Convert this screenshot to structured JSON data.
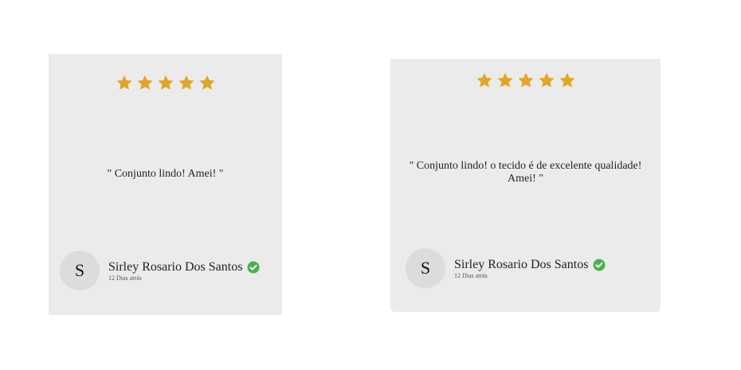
{
  "colors": {
    "card_background": "#ebebeb",
    "star": "#e2a526",
    "verified": "#4caf50",
    "avatar_background": "#dcdcdc"
  },
  "reviews": [
    {
      "rating": 5,
      "text": "\" Conjunto lindo! Amei! \"",
      "author_initial": "S",
      "author_name": "Sirley Rosario Dos Santos",
      "date": "12 Dias atrás",
      "verified_icon": "check-circle-icon"
    },
    {
      "rating": 5,
      "text": "\" Conjunto lindo! o tecido é de excelente qualidade! Amei! \"",
      "author_initial": "S",
      "author_name": "Sirley Rosario Dos Santos",
      "date": "12 Dias atrás",
      "verified_icon": "check-circle-icon"
    }
  ]
}
